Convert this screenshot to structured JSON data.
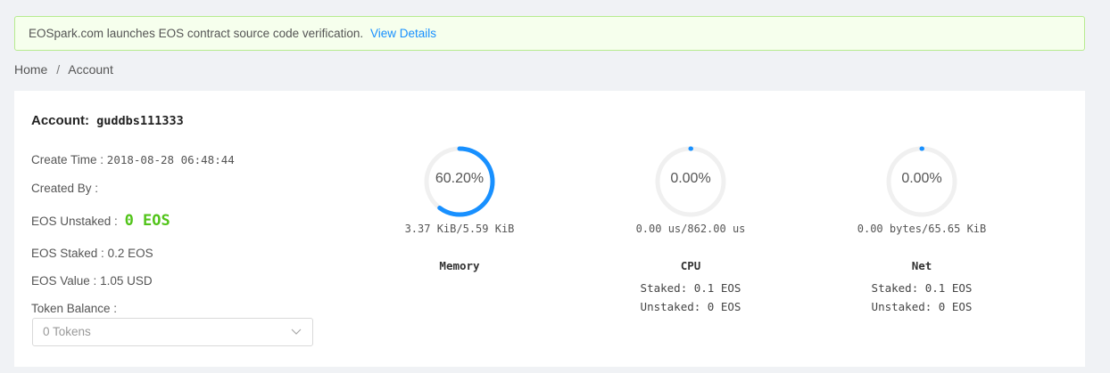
{
  "notice": {
    "text": "EOSpark.com launches EOS contract source code verification.",
    "link": "View Details"
  },
  "breadcrumb": {
    "home": "Home",
    "separator": "/",
    "current": "Account"
  },
  "account": {
    "title_label": "Account:",
    "name": "guddbs111333",
    "create_time_label": "Create Time :",
    "create_time": "2018-08-28 06:48:44",
    "created_by_label": "Created By :",
    "unstaked_label": "EOS Unstaked :",
    "unstaked_value": "0 EOS",
    "staked_label": "EOS Staked :",
    "staked_value": "0.2 EOS",
    "value_label": "EOS Value :",
    "value_value": "1.05 USD",
    "token_balance_label": "Token Balance :",
    "token_select": "0 Tokens"
  },
  "resources": {
    "memory": {
      "percent": 60.2,
      "percent_text": "60.20%",
      "usage": "3.37 KiB/5.59 KiB",
      "label": "Memory"
    },
    "cpu": {
      "percent": 0,
      "percent_text": "0.00%",
      "usage": "0.00 us/862.00 us",
      "label": "CPU",
      "staked": "Staked: 0.1 EOS",
      "unstaked": "Unstaked: 0 EOS"
    },
    "net": {
      "percent": 0,
      "percent_text": "0.00%",
      "usage": "0.00 bytes/65.65 KiB",
      "label": "Net",
      "staked": "Staked: 0.1 EOS",
      "unstaked": "Unstaked: 0 EOS"
    }
  },
  "colors": {
    "accent": "#1890ff",
    "track": "#f0f0f0",
    "green": "#52c41a"
  }
}
